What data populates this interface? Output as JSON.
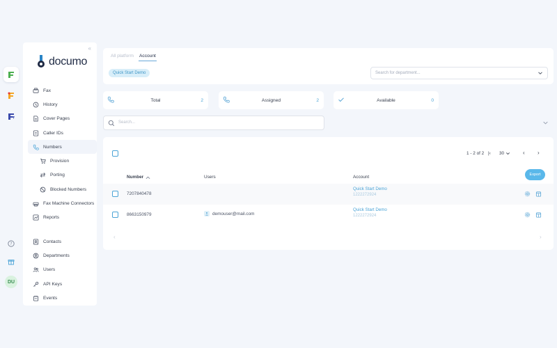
{
  "rail": {
    "apps": [
      {
        "name": "documo-app",
        "glyph": "ℱ",
        "color": "#4caf50"
      },
      {
        "name": "mfax-app",
        "glyph": "ℱ",
        "color": "#f5a623"
      },
      {
        "name": "fax-app",
        "glyph": "ℱ",
        "color": "#3949ab"
      }
    ],
    "avatar": "DU"
  },
  "sidebar": {
    "logo_text": "documo",
    "items": [
      {
        "id": "fax",
        "label": "Fax",
        "icon": "fax-icon"
      },
      {
        "id": "history",
        "label": "History",
        "icon": "history-icon"
      },
      {
        "id": "cover-pages",
        "label": "Cover Pages",
        "icon": "document-icon"
      },
      {
        "id": "caller-ids",
        "label": "Caller IDs",
        "icon": "caller-id-icon"
      },
      {
        "id": "numbers",
        "label": "Numbers",
        "icon": "phone-icon",
        "active": true
      },
      {
        "id": "provision",
        "label": "Provision",
        "icon": "cart-icon",
        "sub": true
      },
      {
        "id": "porting",
        "label": "Porting",
        "icon": "swap-icon",
        "sub": true
      },
      {
        "id": "blocked-numbers",
        "label": "Blocked Numbers",
        "icon": "block-icon",
        "sub": true
      },
      {
        "id": "fax-machine-connectors",
        "label": "Fax Machine Connectors",
        "icon": "printer-icon"
      },
      {
        "id": "reports",
        "label": "Reports",
        "icon": "chart-icon"
      }
    ],
    "items2": [
      {
        "id": "contacts",
        "label": "Contacts",
        "icon": "contacts-icon"
      },
      {
        "id": "departments",
        "label": "Departments",
        "icon": "departments-icon"
      },
      {
        "id": "users",
        "label": "Users",
        "icon": "users-icon"
      },
      {
        "id": "api-keys",
        "label": "API Keys",
        "icon": "key-icon"
      },
      {
        "id": "events",
        "label": "Events",
        "icon": "events-icon"
      }
    ]
  },
  "tabs": {
    "all": "All platform",
    "account": "Account"
  },
  "chip": "Quick Start Demo",
  "department_select": {
    "placeholder": "Search for department..."
  },
  "stats": [
    {
      "label": "Total",
      "count": "2",
      "icon": "phone-icon"
    },
    {
      "label": "Assigned",
      "count": "2",
      "icon": "phone-call-icon"
    },
    {
      "label": "Available",
      "count": "0",
      "icon": "check-icon"
    }
  ],
  "search": {
    "placeholder": "Search..."
  },
  "table": {
    "pager": {
      "range": "1 - 2 of 2",
      "page_size": "30"
    },
    "headers": {
      "number": "Number",
      "users": "Users",
      "account": "Account"
    },
    "export_label": "Export",
    "rows": [
      {
        "number": "7207840478",
        "user": "",
        "account_name": "Quick Start Demo",
        "account_id": "1222272924"
      },
      {
        "number": "8663150979",
        "user": "demouser@mail.com",
        "account_name": "Quick Start Demo",
        "account_id": "1222272924"
      }
    ]
  },
  "colors": {
    "accent": "#4aa3d6",
    "background": "#f3f6fb"
  }
}
